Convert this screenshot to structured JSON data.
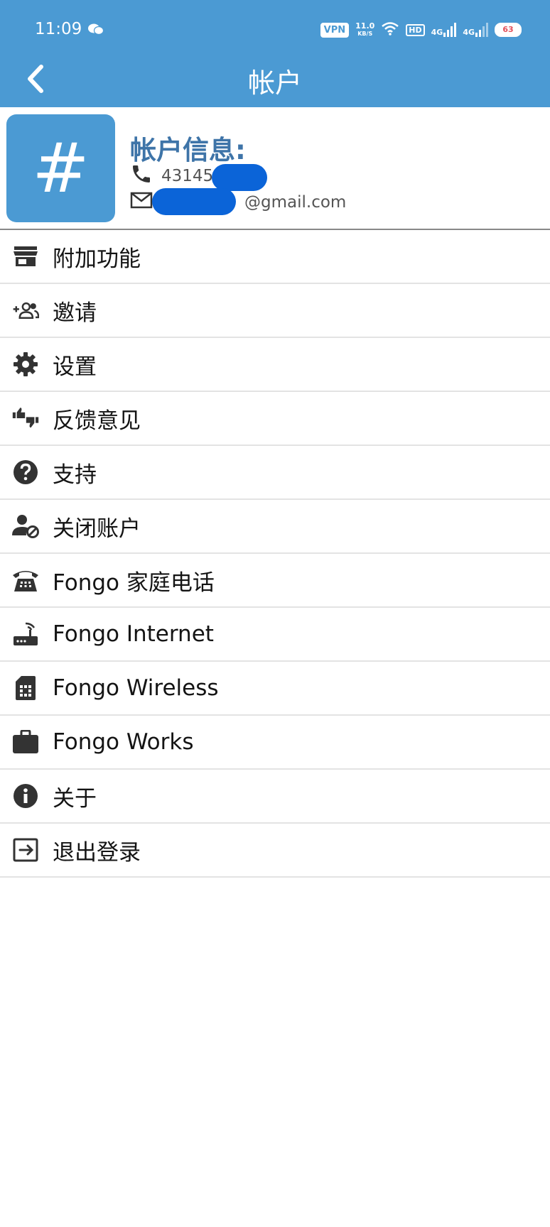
{
  "status_bar": {
    "time": "11:09",
    "vpn": "VPN",
    "speed_value": "11.0",
    "speed_unit": "KB/S",
    "hd": "HD",
    "net1": "4G",
    "net2": "4G",
    "battery": "63"
  },
  "header": {
    "title": "帐户",
    "back_icon": "chevron-left-icon"
  },
  "account": {
    "avatar_symbol": "#",
    "title": "帐户信息:",
    "phone_visible": "43145",
    "email_visible": "@gmail.com"
  },
  "menu": {
    "items": [
      {
        "label": "附加功能",
        "icon": "store-icon"
      },
      {
        "label": "邀请",
        "icon": "add-people-icon"
      },
      {
        "label": "设置",
        "icon": "gear-icon"
      },
      {
        "label": "反馈意见",
        "icon": "thumbs-feedback-icon"
      },
      {
        "label": "支持",
        "icon": "help-icon"
      },
      {
        "label": "关闭账户",
        "icon": "user-block-icon"
      },
      {
        "label": "Fongo 家庭电话",
        "icon": "desk-phone-icon"
      },
      {
        "label": "Fongo Internet",
        "icon": "router-icon"
      },
      {
        "label": "Fongo Wireless",
        "icon": "sim-card-icon"
      },
      {
        "label": "Fongo Works",
        "icon": "briefcase-icon"
      },
      {
        "label": "关于",
        "icon": "info-icon"
      },
      {
        "label": "退出登录",
        "icon": "logout-icon"
      }
    ]
  },
  "colors": {
    "accent": "#4b9ad3",
    "account_title": "#3e74a8",
    "redaction": "#0b64d8"
  }
}
